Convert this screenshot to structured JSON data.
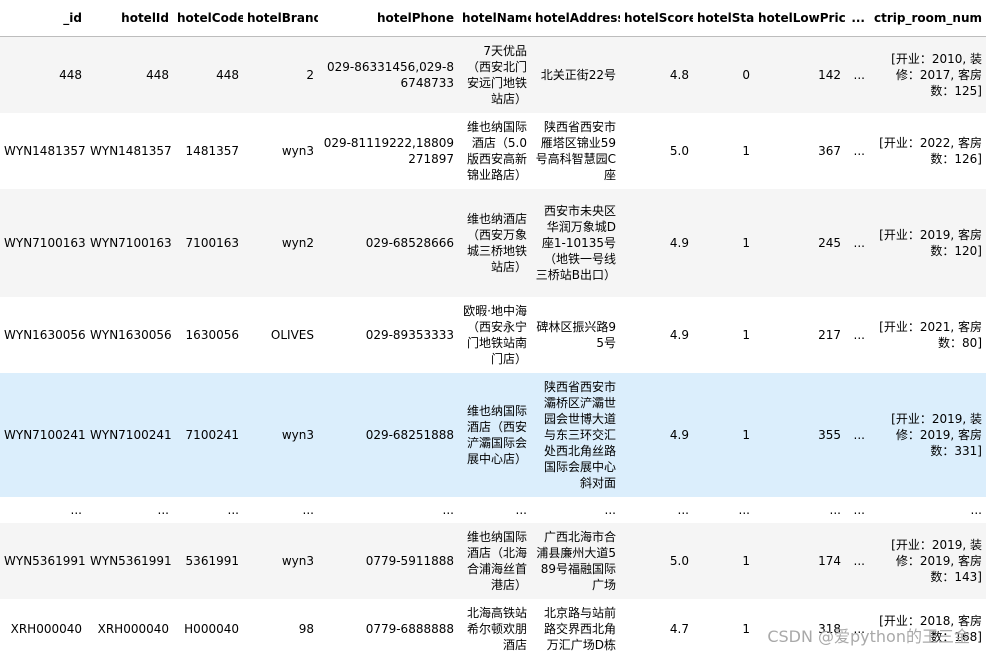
{
  "columns": [
    "_id",
    "hotelId",
    "hotelCode",
    "hotelBrand",
    "hotelPhone",
    "hotelName",
    "hotelAddress",
    "hotelScore",
    "hotelStar",
    "hotelLowPrice",
    "...",
    "ctrip_room_num"
  ],
  "rows": [
    {
      "_id": "448",
      "hotelId": "448",
      "hotelCode": "448",
      "hotelBrand": "2",
      "hotelPhone": "029-86331456,029-86748733",
      "hotelName": "7天优品（西安北门安远门地铁站店）",
      "hotelAddress": "北关正街22号",
      "hotelScore": "4.8",
      "hotelStar": "0",
      "hotelLowPrice": "142",
      "ellipsis": "...",
      "ctrip_room_num": "[开业：2010, 装修：2017, 客房数：125]"
    },
    {
      "_id": "WYN1481357",
      "hotelId": "WYN1481357",
      "hotelCode": "1481357",
      "hotelBrand": "wyn3",
      "hotelPhone": "029-81119222,18809271897",
      "hotelName": "维也纳国际酒店（5.0版西安高新锦业路店）",
      "hotelAddress": "陕西省西安市雁塔区锦业59号高科智慧园C座",
      "hotelScore": "5.0",
      "hotelStar": "1",
      "hotelLowPrice": "367",
      "ellipsis": "...",
      "ctrip_room_num": "[开业：2022, 客房数：126]"
    },
    {
      "_id": "WYN7100163",
      "hotelId": "WYN7100163",
      "hotelCode": "7100163",
      "hotelBrand": "wyn2",
      "hotelPhone": "029-68528666",
      "hotelName": "维也纳酒店（西安万象城三桥地铁站店）",
      "hotelAddress": "西安市未央区华润万象城D座1-10135号（地铁一号线三桥站B出口）",
      "hotelScore": "4.9",
      "hotelStar": "1",
      "hotelLowPrice": "245",
      "ellipsis": "...",
      "ctrip_room_num": "[开业：2019, 客房数：120]"
    },
    {
      "_id": "WYN1630056",
      "hotelId": "WYN1630056",
      "hotelCode": "1630056",
      "hotelBrand": "OLIVES",
      "hotelPhone": "029-89353333",
      "hotelName": "欧暇·地中海（西安永宁门地铁站南门店）",
      "hotelAddress": "碑林区振兴路95号",
      "hotelScore": "4.9",
      "hotelStar": "1",
      "hotelLowPrice": "217",
      "ellipsis": "...",
      "ctrip_room_num": "[开业：2021, 客房数：80]"
    },
    {
      "_id": "WYN7100241",
      "hotelId": "WYN7100241",
      "hotelCode": "7100241",
      "hotelBrand": "wyn3",
      "hotelPhone": "029-68251888",
      "hotelName": "维也纳国际酒店（西安浐灞国际会展中心店）",
      "hotelAddress": "陕西省西安市灞桥区浐灞世园会世博大道与东三环交汇处西北角丝路国际会展中心斜对面",
      "hotelScore": "4.9",
      "hotelStar": "1",
      "hotelLowPrice": "355",
      "ellipsis": "...",
      "ctrip_room_num": "[开业：2019, 装修：2019, 客房数：331]"
    },
    {
      "_id": "...",
      "hotelId": "...",
      "hotelCode": "...",
      "hotelBrand": "...",
      "hotelPhone": "...",
      "hotelName": "...",
      "hotelAddress": "...",
      "hotelScore": "...",
      "hotelStar": "...",
      "hotelLowPrice": "...",
      "ellipsis": "...",
      "ctrip_room_num": "..."
    },
    {
      "_id": "WYN5361991",
      "hotelId": "WYN5361991",
      "hotelCode": "5361991",
      "hotelBrand": "wyn3",
      "hotelPhone": "0779-5911888",
      "hotelName": "维也纳国际酒店（北海合浦海丝首港店）",
      "hotelAddress": "广西北海市合浦县廉州大道589号福融国际广场",
      "hotelScore": "5.0",
      "hotelStar": "1",
      "hotelLowPrice": "174",
      "ellipsis": "...",
      "ctrip_room_num": "[开业：2019, 装修：2019, 客房数：143]"
    },
    {
      "_id": "XRH000040",
      "hotelId": "XRH000040",
      "hotelCode": "H000040",
      "hotelBrand": "98",
      "hotelPhone": "0779-6888888",
      "hotelName": "北海高铁站希尔顿欢朋酒店",
      "hotelAddress": "北京路与站前路交界西北角万汇广场D栋",
      "hotelScore": "4.7",
      "hotelStar": "1",
      "hotelLowPrice": "318",
      "ellipsis": "...",
      "ctrip_room_num": "[开业：2018, 客房数：168]"
    }
  ],
  "highlighted_row": 4,
  "watermark": "CSDN @爱python的王三金"
}
